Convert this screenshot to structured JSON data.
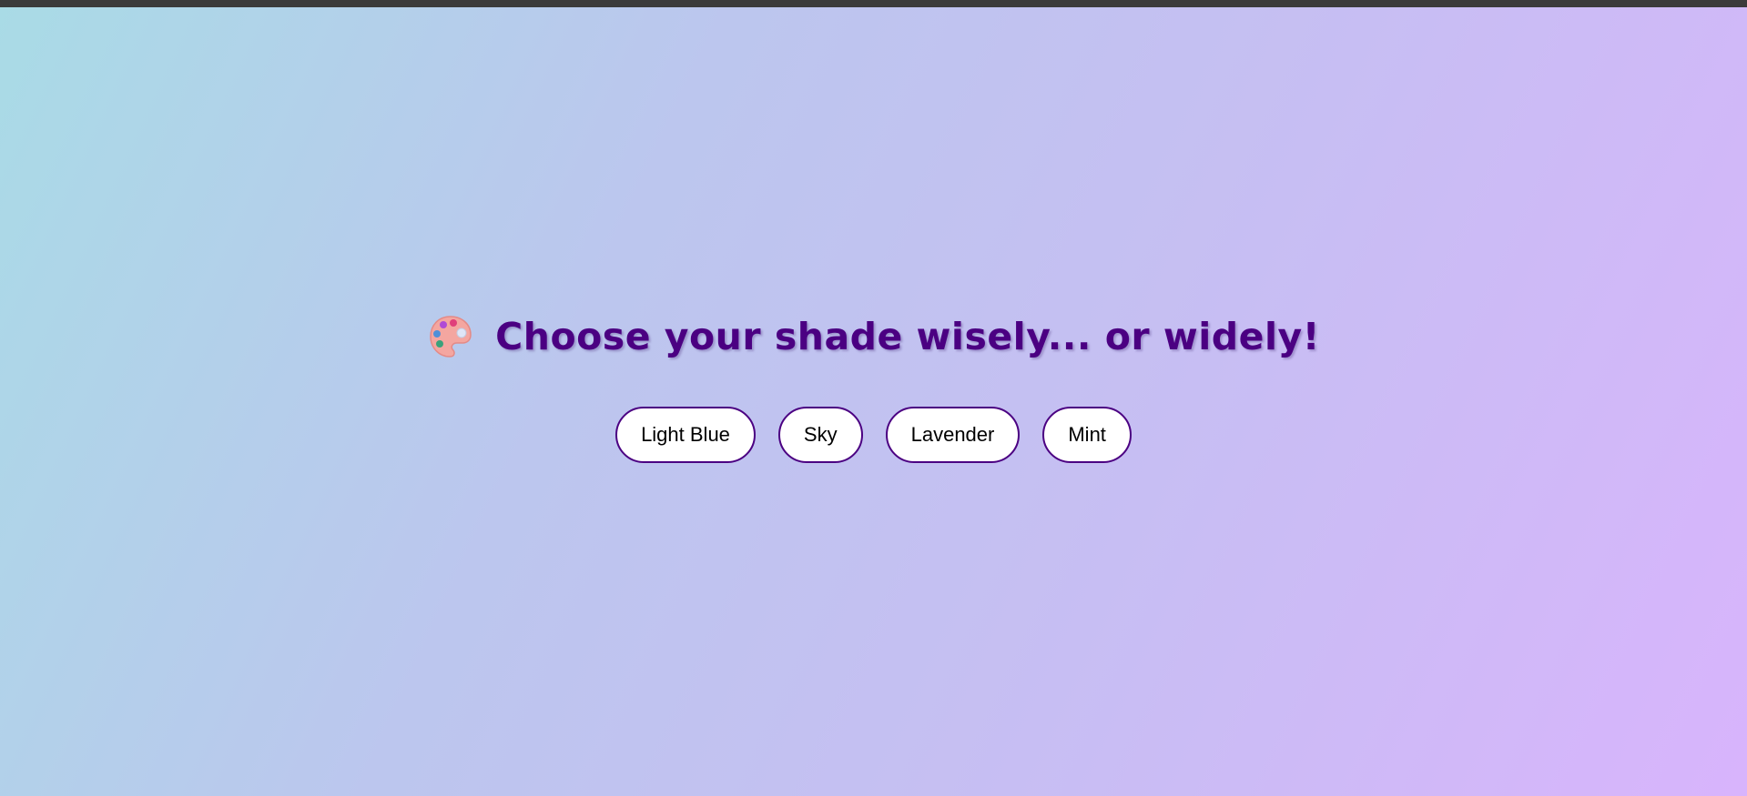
{
  "heading": {
    "icon": "artist-palette-icon",
    "title": "Choose your shade wisely... or widely!"
  },
  "shades": [
    {
      "label": "Light Blue"
    },
    {
      "label": "Sky"
    },
    {
      "label": "Lavender"
    },
    {
      "label": "Mint"
    }
  ],
  "colors": {
    "title": "#4b0082",
    "button_border": "#4b0082",
    "button_background": "#ffffff",
    "gradient_start": "#a9dbe6",
    "gradient_end": "#d8b4fc"
  }
}
